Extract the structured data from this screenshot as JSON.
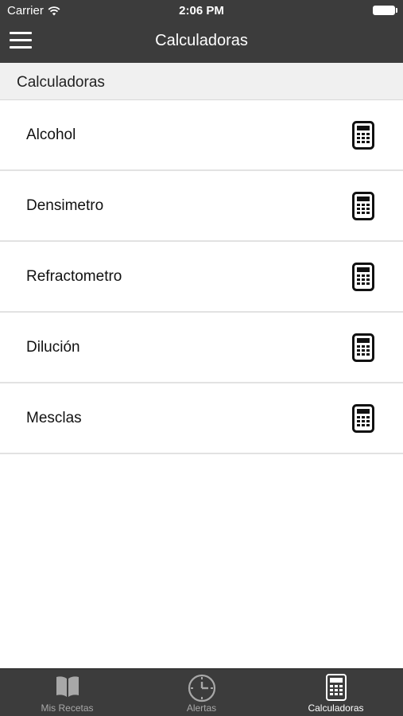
{
  "status_bar": {
    "carrier": "Carrier",
    "time": "2:06 PM"
  },
  "nav": {
    "title": "Calculadoras",
    "menu_icon": "hamburger-menu-icon"
  },
  "section": {
    "header": "Calculadoras"
  },
  "list": {
    "items": [
      {
        "label": "Alcohol",
        "icon": "calculator-icon"
      },
      {
        "label": "Densimetro",
        "icon": "calculator-icon"
      },
      {
        "label": "Refractometro",
        "icon": "calculator-icon"
      },
      {
        "label": "Dilución",
        "icon": "calculator-icon"
      },
      {
        "label": "Mesclas",
        "icon": "calculator-icon"
      }
    ]
  },
  "tabbar": {
    "tabs": [
      {
        "label": "Mis Recetas",
        "icon": "book-icon",
        "active": false
      },
      {
        "label": "Alertas",
        "icon": "clock-icon",
        "active": false
      },
      {
        "label": "Calculadoras",
        "icon": "calculator-icon",
        "active": true
      }
    ]
  },
  "colors": {
    "bar_background": "#3c3c3c",
    "section_background": "#f0f0f0",
    "active_tab_text": "#ffffff",
    "inactive_tab_text": "#a8a8a8"
  }
}
